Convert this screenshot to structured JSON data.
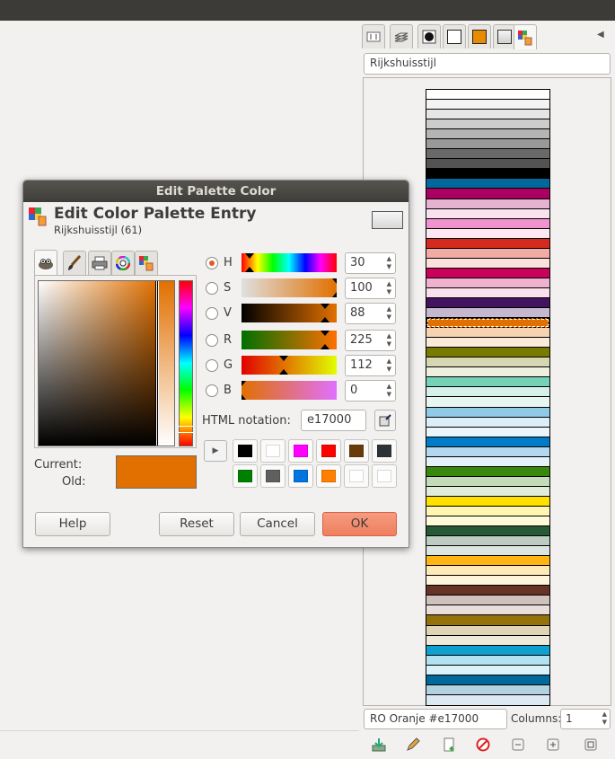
{
  "dock": {
    "palette_name": "Rijkshuisstijl",
    "color_name": "RO Oranje #e17000",
    "columns_label": "Columns:",
    "columns_value": "1",
    "tabs": [
      "tool-options-icon",
      "layers-icon",
      "brushes-icon",
      "white-swatch-icon",
      "orange-swatch-icon",
      "patterns-icon",
      "palette-icon"
    ],
    "swatches": [
      "#ffffff",
      "#f3f3f3",
      "#e6e6e6",
      "#cccccc",
      "#b4b4b4",
      "#999999",
      "#696969",
      "#535353",
      "#000000",
      "#01689b",
      "#a90061",
      "#e5b2cf",
      "#f9e2ee",
      "#f092cd",
      "#fce7f2",
      "#d52b1e",
      "#f2aaa5",
      "#fbe0de",
      "#ca005d",
      "#efb2ce",
      "#f9e0ec",
      "#42145f",
      "#c6b8cf",
      "#e17000",
      "#f6d4b2",
      "#fde9d8",
      "#777c00",
      "#d6d7b2",
      "#efefe0",
      "#76d2b6",
      "#d6f1e9",
      "#e8f6f2",
      "#8fcae7",
      "#dceef8",
      "#eaf5fb",
      "#007bc7",
      "#b2d7ee",
      "#e5f2fa",
      "#39870c",
      "#c3dbb6",
      "#e1eddb",
      "#ffe000",
      "#fff6b2",
      "#fffbd9",
      "#275937",
      "#bdccc3",
      "#dde5e0",
      "#ffb612",
      "#ffe9b7",
      "#fff4dc",
      "#673327",
      "#d1c1be",
      "#e8dfdd",
      "#94710a",
      "#dfd4b5",
      "#efe9da",
      "#0fa0d0",
      "#b2e2f1",
      "#dcf2f9",
      "#01689b",
      "#b2d2e1",
      "#dde9f2"
    ]
  },
  "dialog": {
    "title": "Edit Palette Color",
    "header_title": "Edit Color Palette Entry",
    "header_subtitle": "Rijkshuisstijl (61)",
    "current_label": "Current:",
    "old_label": "Old:",
    "current_color": "#e17000",
    "old_color": "#e17000",
    "channels": [
      {
        "label": "H",
        "value": "30",
        "selected": true,
        "marker": 0.083
      },
      {
        "label": "S",
        "value": "100",
        "selected": false,
        "marker": 1.0
      },
      {
        "label": "V",
        "value": "88",
        "selected": false,
        "marker": 0.88
      },
      {
        "label": "R",
        "value": "225",
        "selected": false,
        "marker": 0.88
      },
      {
        "label": "G",
        "value": "112",
        "selected": false,
        "marker": 0.44
      },
      {
        "label": "B",
        "value": "0",
        "selected": false,
        "marker": 0.0
      }
    ],
    "html_label": "HTML notation:",
    "html_value": "e17000",
    "history": [
      "#000000",
      "#ffffff",
      "#ff00ff",
      "#ff0000",
      "#6b3a0a",
      "#2e3436",
      "#008000",
      "#5f5f5f",
      "#0075e0",
      "#ff7f00",
      "#ffffff",
      "#ffffff"
    ],
    "buttons": {
      "help": "Help",
      "reset": "Reset",
      "cancel": "Cancel",
      "ok": "OK"
    }
  }
}
